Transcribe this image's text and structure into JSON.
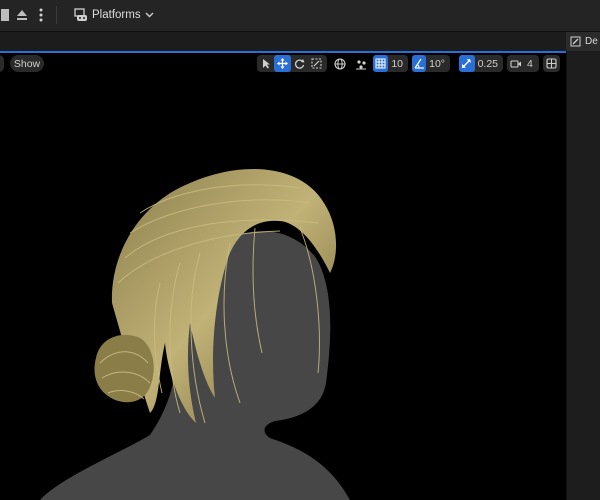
{
  "toolbar": {
    "platforms_label": "Platforms"
  },
  "details_tab": {
    "label": "De"
  },
  "viewport": {
    "show_label": "Show",
    "grid_snap_value": "10",
    "rotation_snap_value": "10°",
    "scale_snap_value": "0.25",
    "camera_speed_value": "4"
  },
  "colors": {
    "accent": "#2a6fd6",
    "hair": "#a99a5f",
    "silhouette": "#474747"
  }
}
